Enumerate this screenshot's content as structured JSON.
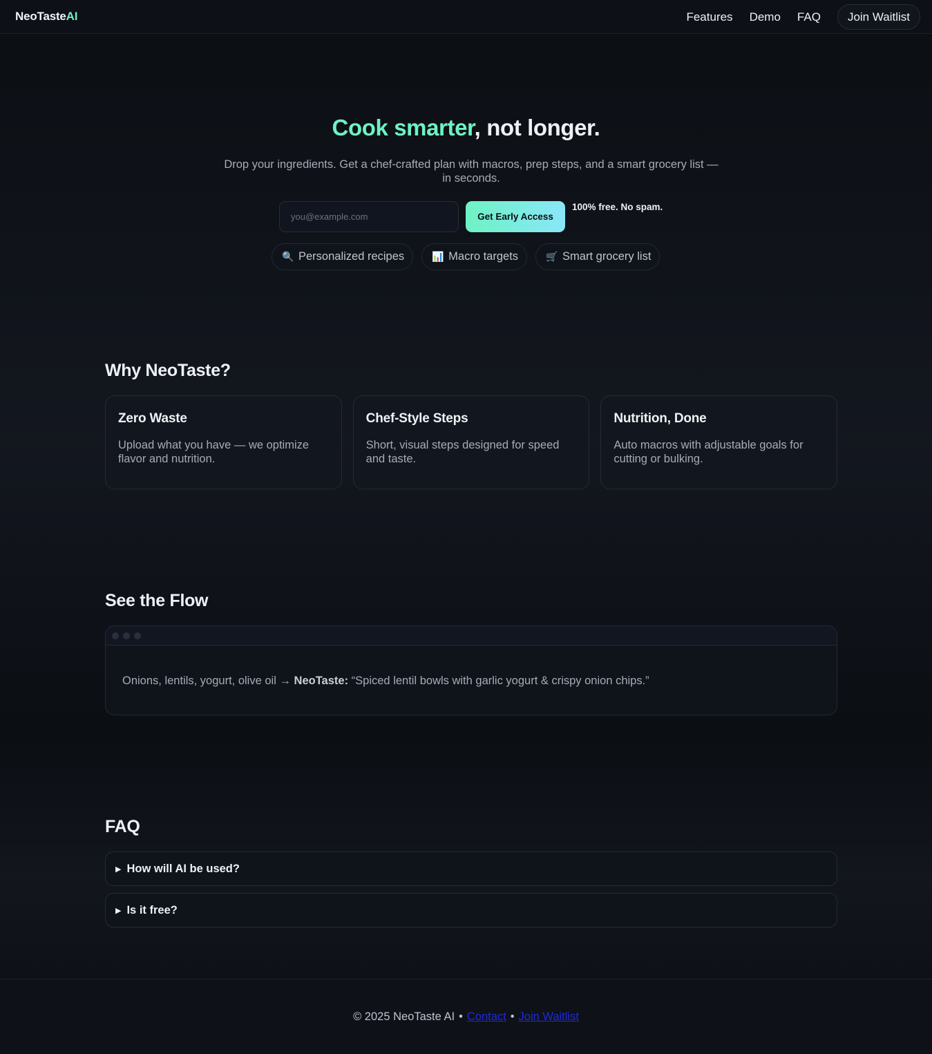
{
  "nav": {
    "logo_main": "NeoTaste",
    "logo_accent": "AI",
    "links": [
      "Features",
      "Demo",
      "FAQ"
    ],
    "cta": "Join Waitlist"
  },
  "hero": {
    "title_highlight": "Cook smarter",
    "title_rest": ", not longer.",
    "subtitle": "Drop your ingredients. Get a chef-crafted plan with macros, prep steps, and a smart grocery list — in seconds.",
    "email_placeholder": "you@example.com",
    "cta": "Get Early Access",
    "note": "100% free. No spam.",
    "pills": [
      {
        "icon": "🔍",
        "icon_name": "magnifier-icon",
        "label": "Personalized recipes"
      },
      {
        "icon": "📊",
        "icon_name": "chart-icon",
        "label": "Macro targets"
      },
      {
        "icon": "🛒",
        "icon_name": "cart-icon",
        "label": "Smart grocery list"
      }
    ]
  },
  "features": {
    "title": "Why NeoTaste?",
    "cards": [
      {
        "title": "Zero Waste",
        "text": "Upload what you have — we optimize flavor and nutrition."
      },
      {
        "title": "Chef-Style Steps",
        "text": "Short, visual steps designed for speed and taste."
      },
      {
        "title": "Nutrition, Done",
        "text": "Auto macros with adjustable goals for cutting or bulking."
      }
    ]
  },
  "demo": {
    "title": "See the Flow",
    "input_text": "Onions, lentils, yogurt, olive oil → ",
    "brand": "NeoTaste:",
    "output_text": " “Spiced lentil bowls with garlic yogurt & crispy onion chips.”"
  },
  "faq": {
    "title": "FAQ",
    "items": [
      "How will AI be used?",
      "Is it free?"
    ]
  },
  "footer": {
    "copyright": "© 2025 NeoTaste AI",
    "separator": "•",
    "contact": "Contact",
    "join": "Join Waitlist"
  },
  "colors": {
    "accent": "#6ef2c4",
    "background": "#0b0e13",
    "link": "#1e2bd6"
  }
}
